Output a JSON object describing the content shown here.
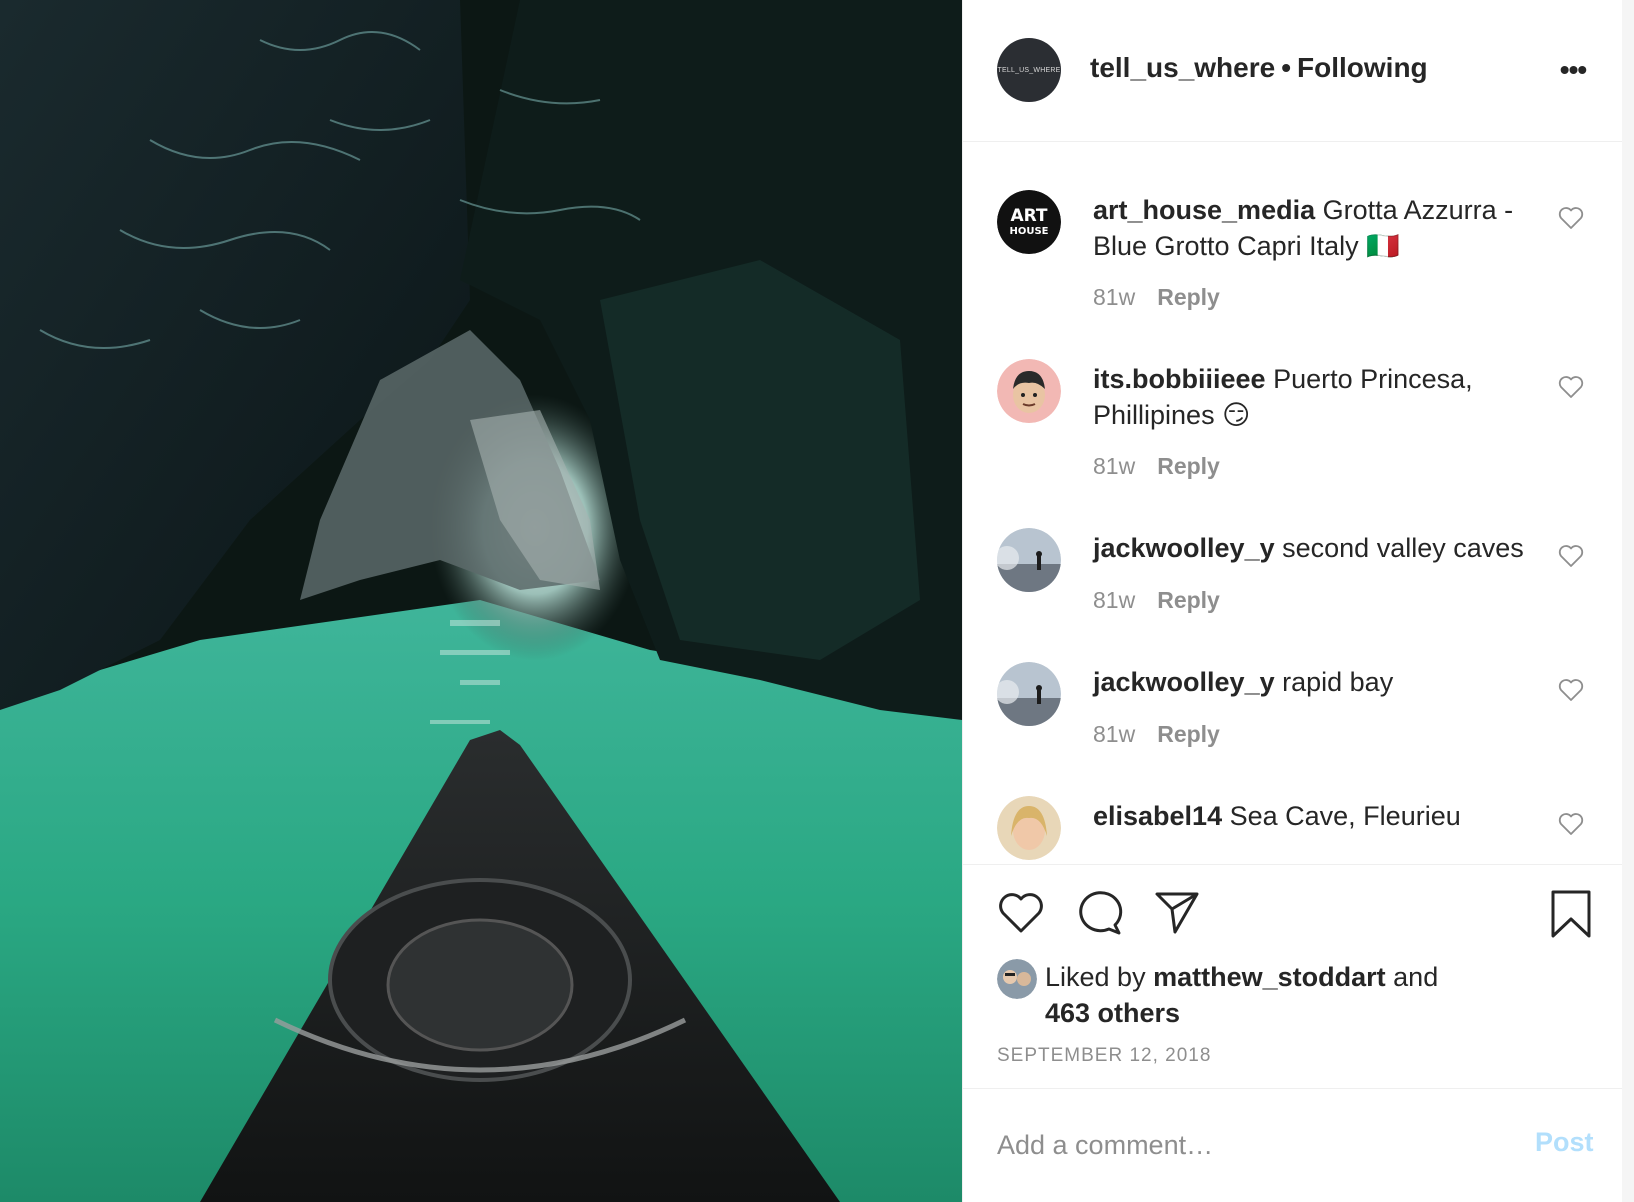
{
  "post": {
    "username": "tell_us_where",
    "separator": "•",
    "follow_status": "Following",
    "avatar_text": "TELL_US_WHERE",
    "more_label": "•••"
  },
  "comments": [
    {
      "username": "art_house_media",
      "text": "Grotta Azzurra - Blue Grotto Capri Italy",
      "emoji": "🇮🇹",
      "age": "81w",
      "reply": "Reply",
      "avatar_text": "ART HOUSE"
    },
    {
      "username": "its.bobbiiieee",
      "text": "Puerto Princesa, Phillipines",
      "emoji": "😏",
      "age": "81w",
      "reply": "Reply"
    },
    {
      "username": "jackwoolley_y",
      "text": "second valley caves",
      "age": "81w",
      "reply": "Reply"
    },
    {
      "username": "jackwoolley_y",
      "text": "rapid bay",
      "age": "81w",
      "reply": "Reply"
    },
    {
      "username": "elisabel14",
      "text": "Sea Cave, Fleurieu"
    }
  ],
  "likes": {
    "prefix": "Liked by",
    "user": "matthew_stoddart",
    "and": "and",
    "others": "463 others"
  },
  "date": "SEPTEMBER 12, 2018",
  "add_comment": {
    "placeholder": "Add a comment…",
    "post_label": "Post"
  },
  "colors": {
    "text": "#262626",
    "secondary": "#8e8e8e",
    "post_disabled": "#b2dffc",
    "divider": "#efefef"
  }
}
